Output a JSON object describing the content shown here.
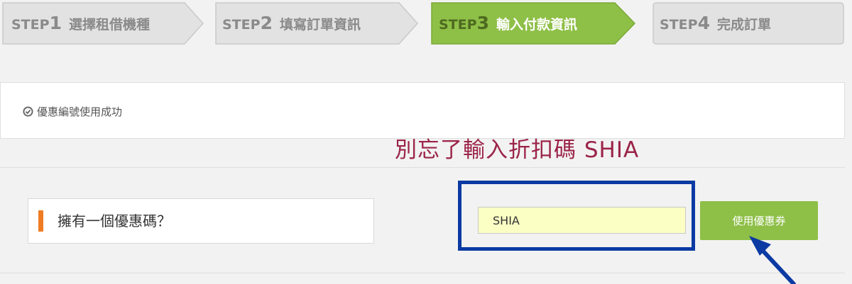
{
  "steps": [
    {
      "lead": "STEP",
      "num": "1",
      "label": "選擇租借機種",
      "active": false
    },
    {
      "lead": "STEP",
      "num": "2",
      "label": "填寫訂單資訊",
      "active": false
    },
    {
      "lead": "STEP",
      "num": "3",
      "label": "輸入付款資訊",
      "active": true
    },
    {
      "lead": "STEP",
      "num": "4",
      "label": "完成訂單",
      "active": false
    }
  ],
  "success": {
    "message": "優惠編號使用成功"
  },
  "annotation": {
    "text": "別忘了輸入折扣碼 SHIA"
  },
  "coupon": {
    "label": "擁有一個優惠碼？",
    "input_value": "SHIA",
    "button_label": "使用優惠券"
  },
  "colors": {
    "step_active": "#8ebf47",
    "step_inactive": "#e2e2e2",
    "accent_orange": "#f07c22",
    "highlight_blue": "#0b3aa3",
    "annotation_text": "#9b2348",
    "input_bg": "#fbffc4"
  },
  "icons": {
    "success": "check-circle-icon",
    "annotation_pointer": "arrow-pointer-icon"
  }
}
